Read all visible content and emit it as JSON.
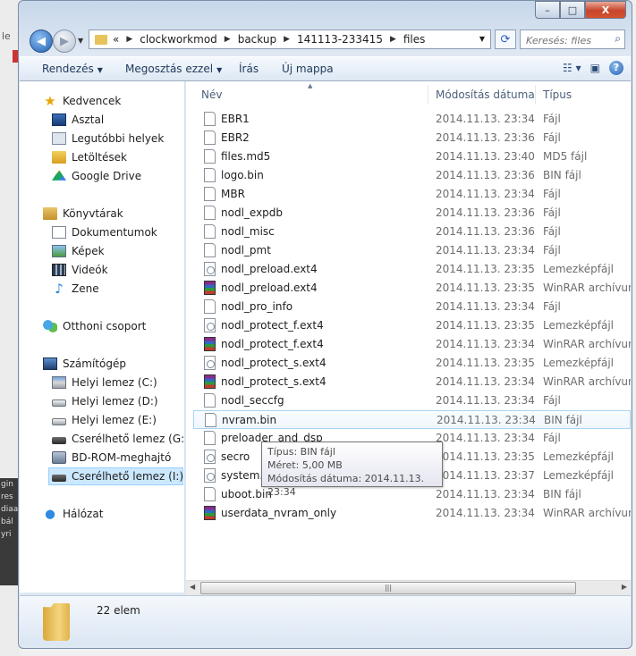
{
  "background": {
    "left_label": "le",
    "dark_strip_lines": [
      "gin",
      "res",
      "diaa",
      "bál",
      "yri"
    ]
  },
  "window": {
    "caption_min": "–",
    "caption_max": "□",
    "caption_close": "X"
  },
  "address": {
    "overflow": "«",
    "crumbs": [
      "clockworkmod",
      "backup",
      "141113-233415",
      "files"
    ]
  },
  "search": {
    "placeholder": "Keresés: files"
  },
  "commandbar": {
    "organize": "Rendezés",
    "share": "Megosztás ezzel",
    "burn": "Írás",
    "new_folder": "Új mappa"
  },
  "navpane": {
    "favorites": "Kedvencek",
    "desktop": "Asztal",
    "recent": "Legutóbbi helyek",
    "downloads": "Letöltések",
    "gdrive": "Google Drive",
    "libraries": "Könyvtárak",
    "documents": "Dokumentumok",
    "pictures": "Képek",
    "videos": "Videók",
    "music": "Zene",
    "homegroup": "Otthoni csoport",
    "computer": "Számítógép",
    "disk_c": "Helyi lemez (C:)",
    "disk_d": "Helyi lemez (D:)",
    "disk_e": "Helyi lemez (E:)",
    "removable_g": "Cserélhető lemez (G:",
    "bdrom": "BD-ROM-meghajtó",
    "removable_i": "Cserélhető lemez (I:)",
    "network": "Hálózat"
  },
  "columns": {
    "name": "Név",
    "date": "Módosítás dátuma",
    "type": "Típus"
  },
  "files": [
    {
      "name": "EBR1",
      "date": "2014.11.13. 23:34",
      "type": "Fájl",
      "icon": "doc"
    },
    {
      "name": "EBR2",
      "date": "2014.11.13. 23:36",
      "type": "Fájl",
      "icon": "doc"
    },
    {
      "name": "files.md5",
      "date": "2014.11.13. 23:40",
      "type": "MD5 fájl",
      "icon": "doc"
    },
    {
      "name": "logo.bin",
      "date": "2014.11.13. 23:36",
      "type": "BIN fájl",
      "icon": "doc"
    },
    {
      "name": "MBR",
      "date": "2014.11.13. 23:34",
      "type": "Fájl",
      "icon": "doc"
    },
    {
      "name": "nodl_expdb",
      "date": "2014.11.13. 23:36",
      "type": "Fájl",
      "icon": "doc"
    },
    {
      "name": "nodl_misc",
      "date": "2014.11.13. 23:36",
      "type": "Fájl",
      "icon": "doc"
    },
    {
      "name": "nodl_pmt",
      "date": "2014.11.13. 23:34",
      "type": "Fájl",
      "icon": "doc"
    },
    {
      "name": "nodl_preload.ext4",
      "date": "2014.11.13. 23:35",
      "type": "Lemezképfájl",
      "icon": "img"
    },
    {
      "name": "nodl_preload.ext4",
      "date": "2014.11.13. 23:35",
      "type": "WinRAR archívum",
      "icon": "rar"
    },
    {
      "name": "nodl_pro_info",
      "date": "2014.11.13. 23:34",
      "type": "Fájl",
      "icon": "doc"
    },
    {
      "name": "nodl_protect_f.ext4",
      "date": "2014.11.13. 23:35",
      "type": "Lemezképfájl",
      "icon": "img"
    },
    {
      "name": "nodl_protect_f.ext4",
      "date": "2014.11.13. 23:34",
      "type": "WinRAR archívum",
      "icon": "rar"
    },
    {
      "name": "nodl_protect_s.ext4",
      "date": "2014.11.13. 23:35",
      "type": "Lemezképfájl",
      "icon": "img"
    },
    {
      "name": "nodl_protect_s.ext4",
      "date": "2014.11.13. 23:34",
      "type": "WinRAR archívum",
      "icon": "rar"
    },
    {
      "name": "nodl_seccfg",
      "date": "2014.11.13. 23:34",
      "type": "Fájl",
      "icon": "doc"
    },
    {
      "name": "nvram.bin",
      "date": "2014.11.13. 23:34",
      "type": "BIN fájl",
      "icon": "doc"
    },
    {
      "name": "preloader_and_dsp",
      "date": "2014.11.13. 23:34",
      "type": "Fájl",
      "icon": "doc"
    },
    {
      "name": "secro",
      "date": "2014.11.13. 23:35",
      "type": "Lemezképfájl",
      "icon": "img"
    },
    {
      "name": "system.e",
      "date": "2014.11.13. 23:37",
      "type": "Lemezképfájl",
      "icon": "img"
    },
    {
      "name": "uboot.bin",
      "date": "2014.11.13. 23:34",
      "type": "BIN fájl",
      "icon": "doc"
    },
    {
      "name": "userdata_nvram_only",
      "date": "2014.11.13. 23:34",
      "type": "WinRAR archívum",
      "icon": "rar"
    }
  ],
  "tooltip": {
    "line1": "Típus: BIN fájl",
    "line2": "Méret: 5,00 MB",
    "line3": "Módosítás dátuma: 2014.11.13. 23:34"
  },
  "details": {
    "count": "22 elem"
  }
}
